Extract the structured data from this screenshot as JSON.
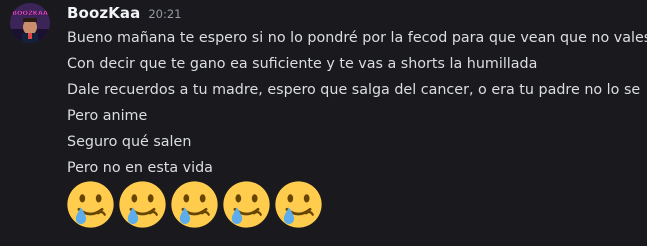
{
  "message": {
    "author": {
      "username": "BoozKaa",
      "avatar_text": "BOOZKAA",
      "avatar_icon": "avatar-image"
    },
    "timestamp": "20:21",
    "lines": [
      "Bueno mañana te espero si no lo pondré por la fecod para que vean que no vales na",
      "Con decir que te gano ea suficiente y te vas a shorts la humillada",
      "Dale recuerdos a tu madre, espero que salga del cancer, o era tu padre no lo se",
      "Pero anime",
      "Seguro qué salen",
      "Pero no en esta vida"
    ],
    "emojis": [
      {
        "name": "face-holding-back-tears-icon",
        "glyph": "🥲"
      },
      {
        "name": "face-holding-back-tears-icon",
        "glyph": "🥲"
      },
      {
        "name": "face-holding-back-tears-icon",
        "glyph": "🥲"
      },
      {
        "name": "face-holding-back-tears-icon",
        "glyph": "🥲"
      },
      {
        "name": "face-holding-back-tears-icon",
        "glyph": "🥲"
      }
    ]
  },
  "colors": {
    "background": "#1a1a1e",
    "username": "#f2f3f5",
    "timestamp": "#949ba4",
    "text": "#dbdee1",
    "emoji_face": "#ffcc4d",
    "emoji_tear": "#5dadec"
  }
}
